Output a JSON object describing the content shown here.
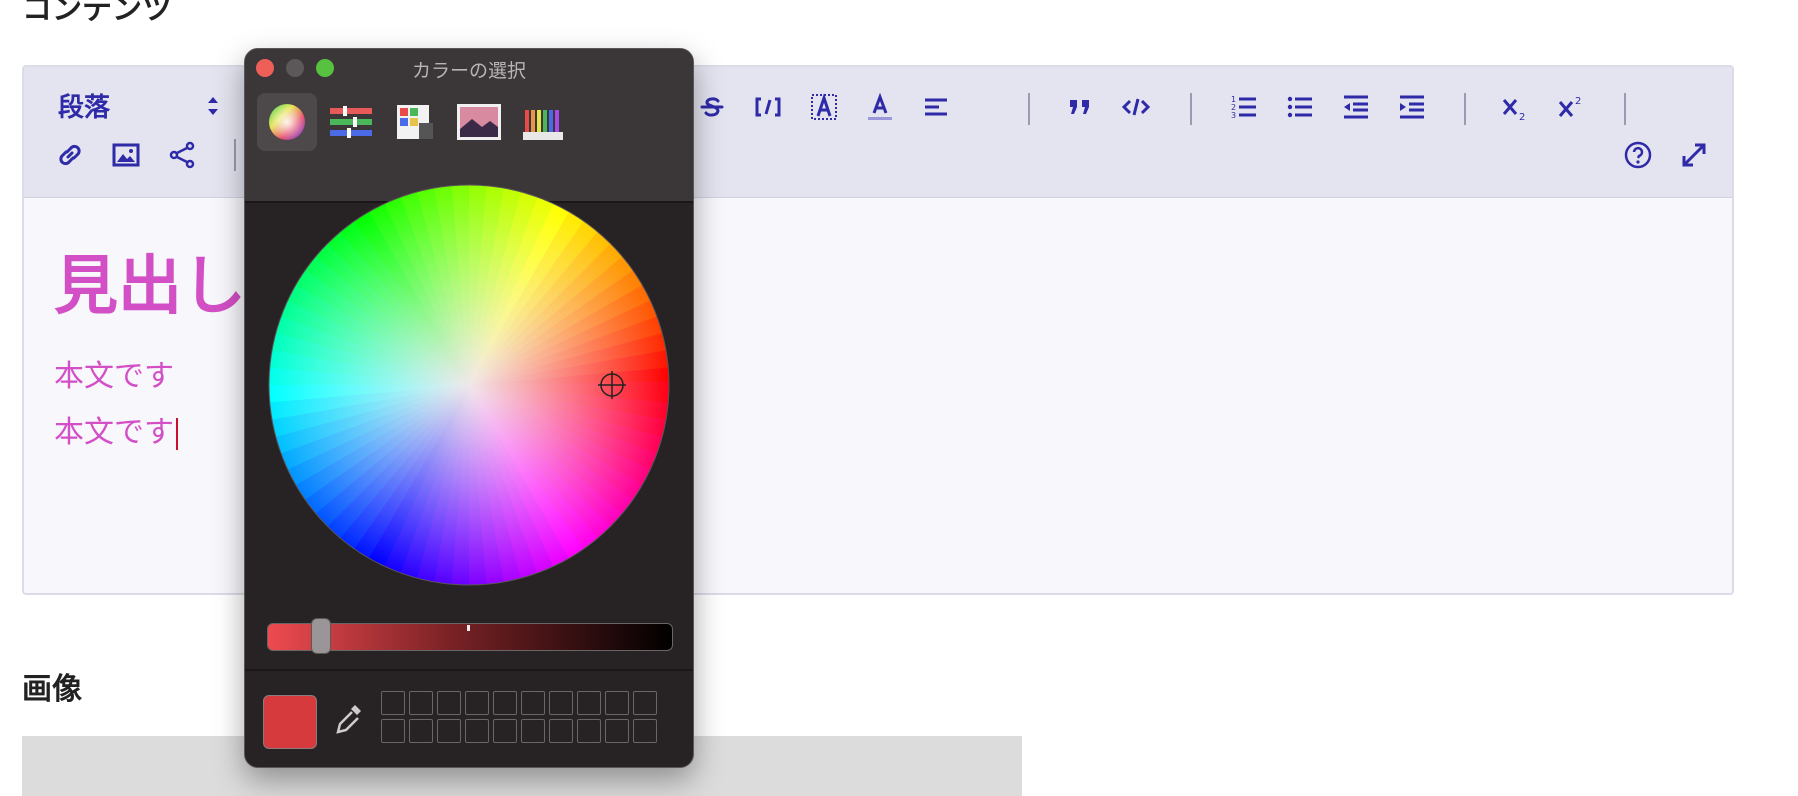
{
  "sections": {
    "contents_title": "コンテンツ",
    "image_title": "画像"
  },
  "toolbar": {
    "block_format": "段落"
  },
  "content": {
    "heading": "見出し",
    "paragraphs": [
      "本文です",
      "本文です"
    ],
    "text_color": "#d24fc6"
  },
  "picker": {
    "title": "カラーの選択",
    "current_color": "#d63a3d",
    "brightness_fraction": 0.18,
    "modes": [
      "color-wheel",
      "color-sliders",
      "color-palettes",
      "image-palettes",
      "pencils"
    ],
    "active_mode": "color-wheel"
  },
  "colors": {
    "toolbar_icon": "#2e2aa8",
    "toolbar_bg": "#e4e4f0",
    "panel_bg": "#272224"
  }
}
